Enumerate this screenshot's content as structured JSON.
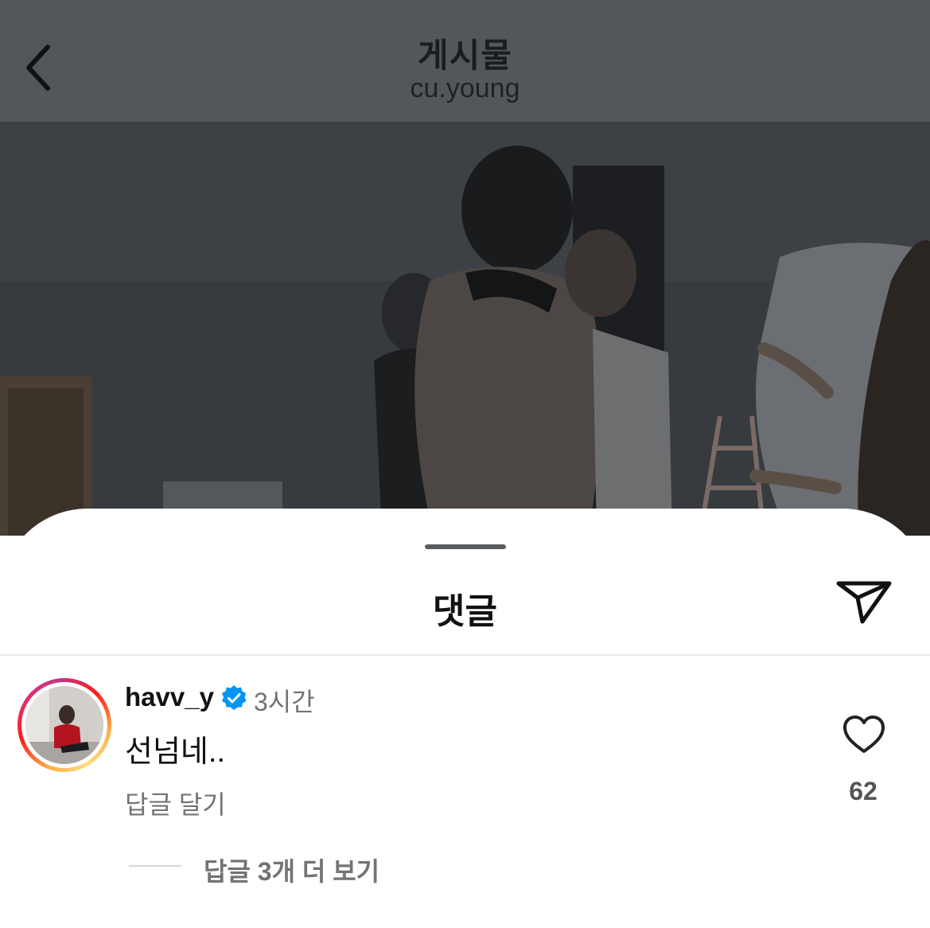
{
  "header": {
    "title": "게시물",
    "subtitle": "cu.young",
    "back_icon": "chevron-left-icon"
  },
  "sheet": {
    "title": "댓글",
    "share_icon": "send-icon"
  },
  "comment": {
    "username": "havv_y",
    "verified_icon": "verified-badge-icon",
    "verified_color": "#0095f6",
    "time": "3시간",
    "text": "선넘네..",
    "reply_label": "답글 달기",
    "like_icon": "heart-outline-icon",
    "like_count": "62",
    "view_replies_label": "답글 3개 더 보기"
  },
  "colors": {
    "dim_overlay": "#545759",
    "secondary_text": "#737373"
  }
}
